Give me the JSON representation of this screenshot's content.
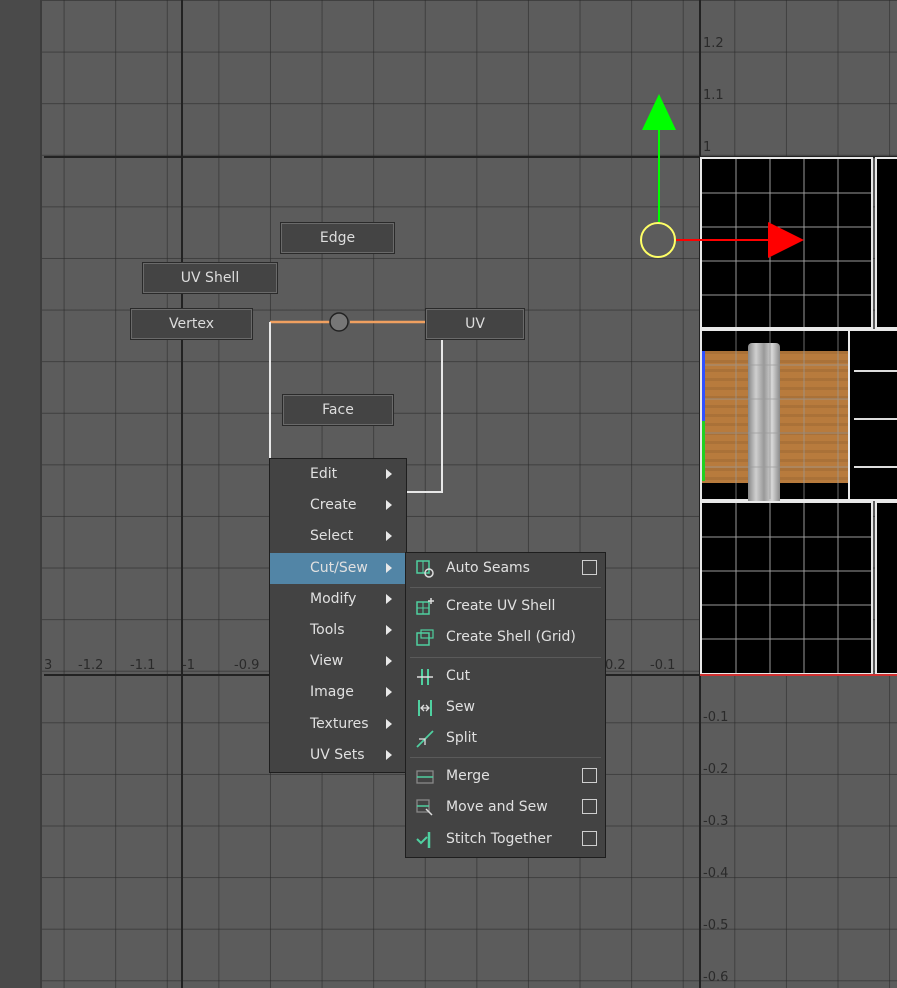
{
  "viewport": {
    "left_ticks": [
      "3",
      "-1.2",
      "-1.1",
      "-1",
      "-0.9"
    ],
    "bottom_ticks": [
      "0.2",
      "-0.1"
    ],
    "right_ticks": [
      "1.2",
      "1.1",
      "1",
      "-0.1",
      "-0.2",
      "-0.3",
      "-0.4",
      "-0.5",
      "-0.6"
    ]
  },
  "marking_menu": {
    "edge": "Edge",
    "uv_shell": "UV Shell",
    "vertex": "Vertex",
    "uv": "UV",
    "face": "Face"
  },
  "context_menu": {
    "items": [
      {
        "label": "Edit"
      },
      {
        "label": "Create"
      },
      {
        "label": "Select"
      },
      {
        "label": "Cut/Sew"
      },
      {
        "label": "Modify"
      },
      {
        "label": "Tools"
      },
      {
        "label": "View"
      },
      {
        "label": "Image"
      },
      {
        "label": "Textures"
      },
      {
        "label": "UV Sets"
      }
    ],
    "active_item": "Cut/Sew"
  },
  "submenu": {
    "items": [
      {
        "label": "Auto Seams",
        "icon": "auto-seams-icon",
        "option_box": true
      },
      {
        "label": "Create UV Shell",
        "icon": "create-uv-shell-icon",
        "option_box": false
      },
      {
        "label": "Create Shell (Grid)",
        "icon": "create-shell-grid-icon",
        "option_box": false
      },
      {
        "label": "Cut",
        "icon": "cut-icon",
        "option_box": false
      },
      {
        "label": "Sew",
        "icon": "sew-icon",
        "option_box": false
      },
      {
        "label": "Split",
        "icon": "split-icon",
        "option_box": false
      },
      {
        "label": "Merge",
        "icon": "merge-icon",
        "option_box": true
      },
      {
        "label": "Move and Sew",
        "icon": "move-and-sew-icon",
        "option_box": true
      },
      {
        "label": "Stitch Together",
        "icon": "stitch-together-icon",
        "option_box": true
      }
    ]
  },
  "colors": {
    "highlight": "#5285a6",
    "gizmo_y": "#00ff00",
    "gizmo_x": "#ff0000",
    "gizmo_center": "#ffff66",
    "marking_line": "#f0a060",
    "wood": "#b87b3d"
  }
}
